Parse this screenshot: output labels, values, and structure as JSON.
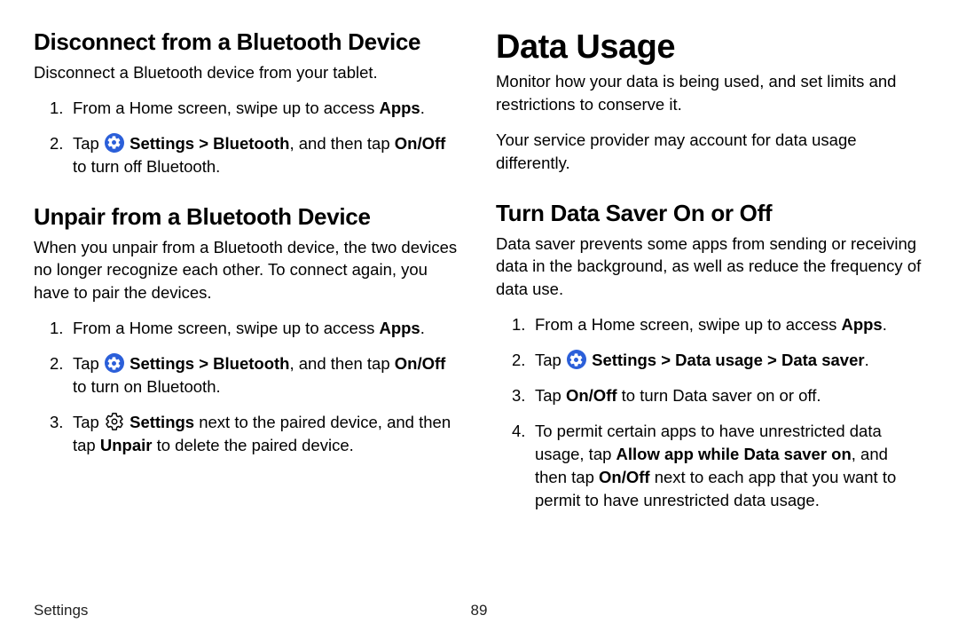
{
  "footer": {
    "section": "Settings",
    "page": "89"
  },
  "left": {
    "sec1": {
      "title": "Disconnect from a Bluetooth Device",
      "intro": "Disconnect a Bluetooth device from your tablet.",
      "step1_pre": "From a Home screen, swipe up to access ",
      "step1_bold": "Apps",
      "step1_post": ".",
      "step2_pre": "Tap ",
      "step2_b1": "Settings > Bluetooth",
      "step2_mid": ", and then tap ",
      "step2_b2": "On/Off",
      "step2_post": " to turn off Bluetooth."
    },
    "sec2": {
      "title": "Unpair from a Bluetooth Device",
      "intro": "When you unpair from a Bluetooth device, the two devices no longer recognize each other. To connect again, you have to pair the devices.",
      "step1_pre": "From a Home screen, swipe up to access ",
      "step1_bold": "Apps",
      "step1_post": ".",
      "step2_pre": "Tap ",
      "step2_b1": "Settings > Bluetooth",
      "step2_mid": ", and then tap ",
      "step2_b2": "On/Off",
      "step2_post": " to turn on Bluetooth.",
      "step3_pre": "Tap ",
      "step3_b1": "Settings",
      "step3_mid": " next to the paired device, and then tap ",
      "step3_b2": "Unpair",
      "step3_post": " to delete the paired device."
    }
  },
  "right": {
    "title": "Data Usage",
    "intro1": "Monitor how your data is being used, and set limits and restrictions to conserve it.",
    "intro2": "Your service provider may account for data usage differently.",
    "sec1": {
      "title": "Turn Data Saver On or Off",
      "intro": "Data saver prevents some apps from sending or receiving data in the background, as well as reduce the frequency of data use.",
      "step1_pre": "From a Home screen, swipe up to access ",
      "step1_bold": "Apps",
      "step1_post": ".",
      "step2_pre": "Tap ",
      "step2_b1": "Settings > Data usage > Data saver",
      "step2_post": ".",
      "step3_pre": "Tap ",
      "step3_b1": "On/Off",
      "step3_post": " to turn Data saver on or off.",
      "step4_pre": "To permit certain apps to have unrestricted data usage, tap ",
      "step4_b1": "Allow app while Data saver on",
      "step4_mid": ", and then tap ",
      "step4_b2": "On/Off",
      "step4_post": " next to each app that you want to permit to have unrestricted data usage."
    }
  },
  "nums": {
    "n1": "1.",
    "n2": "2.",
    "n3": "3.",
    "n4": "4."
  }
}
